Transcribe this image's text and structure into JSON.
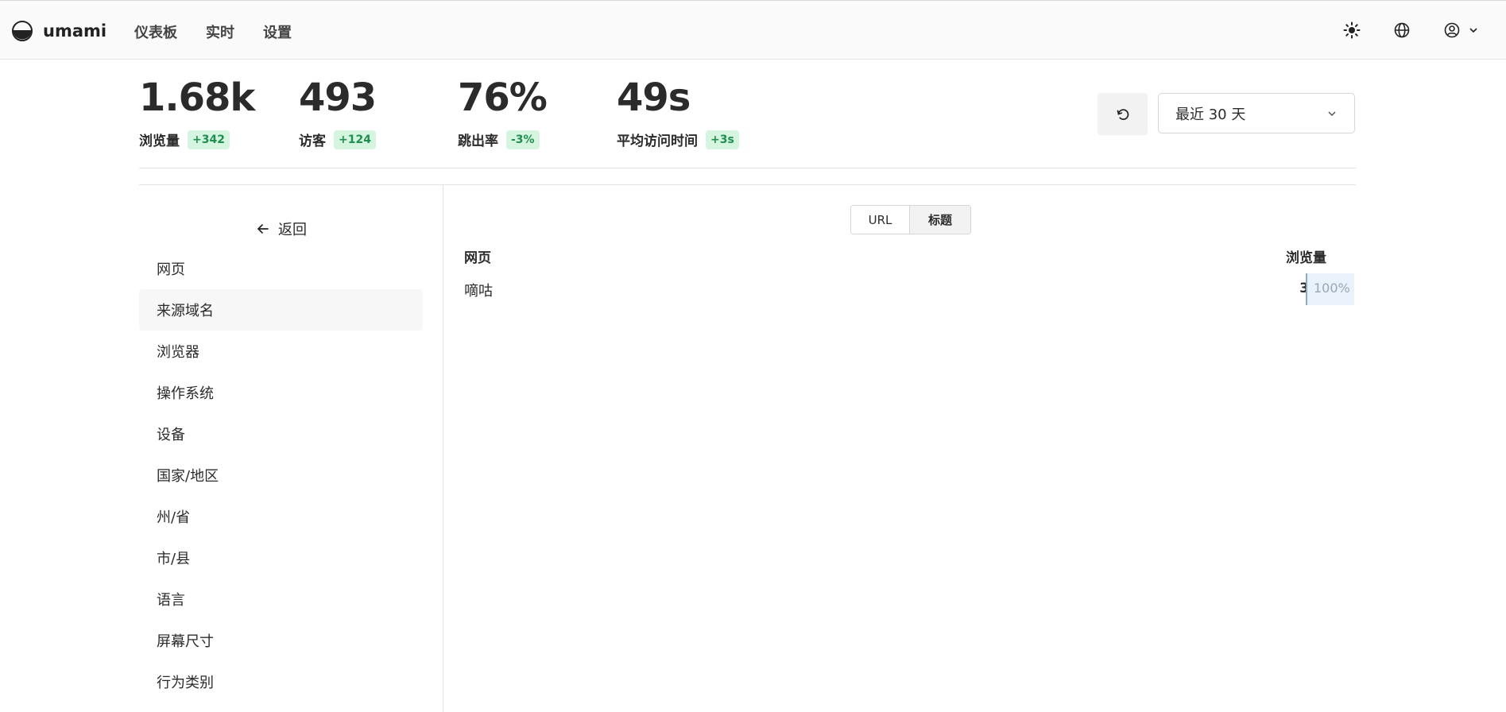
{
  "header": {
    "app_name": "umami",
    "nav": [
      "仪表板",
      "实时",
      "设置"
    ]
  },
  "stats": [
    {
      "value": "1.68k",
      "label": "浏览量",
      "change": "+342"
    },
    {
      "value": "493",
      "label": "访客",
      "change": "+124"
    },
    {
      "value": "76%",
      "label": "跳出率",
      "change": "-3%"
    },
    {
      "value": "49s",
      "label": "平均访问时间",
      "change": "+3s"
    }
  ],
  "date_range": {
    "selected": "最近 30 天"
  },
  "sidebar": {
    "back_label": "返回",
    "items": [
      "网页",
      "来源域名",
      "浏览器",
      "操作系统",
      "设备",
      "国家/地区",
      "州/省",
      "市/县",
      "语言",
      "屏幕尺寸",
      "行为类别"
    ],
    "active_index": 1
  },
  "content": {
    "toggle": {
      "options": [
        "URL",
        "标题"
      ],
      "selected": "标题"
    },
    "table": {
      "col_page": "网页",
      "col_views": "浏览量",
      "rows": [
        {
          "label": "嘀咕",
          "count": "3",
          "percent": "100%",
          "fraction": 1.0
        }
      ]
    }
  },
  "colors": {
    "badge_bg": "#d6f5e1",
    "badge_text": "#1e8f4e",
    "bar_bg": "#e9f1fa",
    "bar_border": "#8aa8c8"
  },
  "icons": {
    "theme": "sun-icon",
    "language": "globe-icon",
    "profile": "user-circle-icon",
    "refresh": "refresh-icon",
    "back": "arrow-left-icon"
  }
}
